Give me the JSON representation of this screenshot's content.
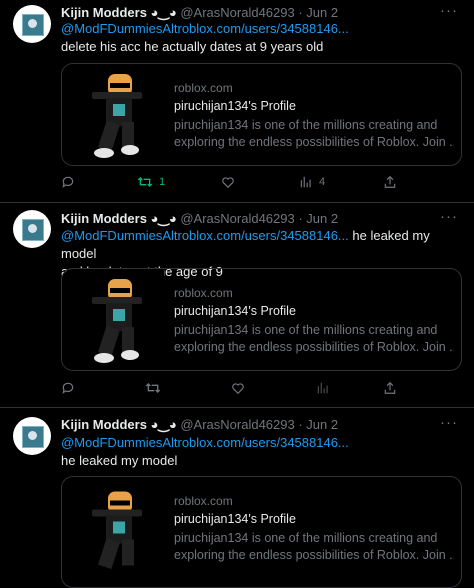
{
  "tweets": [
    {
      "name": "Kijin Modders ◕‿◕",
      "handle": "@ArasNorald46293",
      "date": "",
      "link": "@ModFDummiesAltroblox.com/users/34588146...",
      "text": "delete his acc he actually dates at 9 years old",
      "card": {
        "domain": "roblox.com",
        "title": "piruchijan134's Profile",
        "desc1": "piruchijan134 is one of the millions creating and",
        "desc2": "exploring the endless possibilities of Roblox. Join ..."
      },
      "retweets": "1",
      "views": "4"
    },
    {
      "name": "Kijin Modders ◕‿◕",
      "handle": "@ArasNorald46293 · Jun 2",
      "link": "@ModFDummiesAltroblox.com/users/34588146...",
      "text_after_link": " he leaked my model",
      "text": "and he dates at the age of 9",
      "card": {
        "domain": "roblox.com",
        "title": "piruchijan134's Profile",
        "desc1": "piruchijan134 is one of the millions creating and",
        "desc2": "exploring the endless possibilities of Roblox. Join ..."
      }
    },
    {
      "name": "Kijin Modders ◕‿◕",
      "handle": "@ArasNorald46293 · Jun 2",
      "link": "@ModFDummiesAltroblox.com/users/34588146...",
      "text": "he leaked my model",
      "card": {
        "domain": "roblox.com",
        "title": "piruchijan134's Profile",
        "desc1": "piruchijan134 is one of the millions creating and",
        "desc2": "exploring the endless possibilities of Roblox. Join ..."
      }
    }
  ],
  "first_header_suffix": "@ArasNorald46293 · Jun 2",
  "more_label": "···",
  "icons": [
    "reply-icon",
    "retweet-icon",
    "like-icon",
    "views-icon",
    "share-icon"
  ],
  "colors": {
    "link": "#1d9bf0",
    "retweet_active": "#00ba7c",
    "muted": "#71767b"
  }
}
